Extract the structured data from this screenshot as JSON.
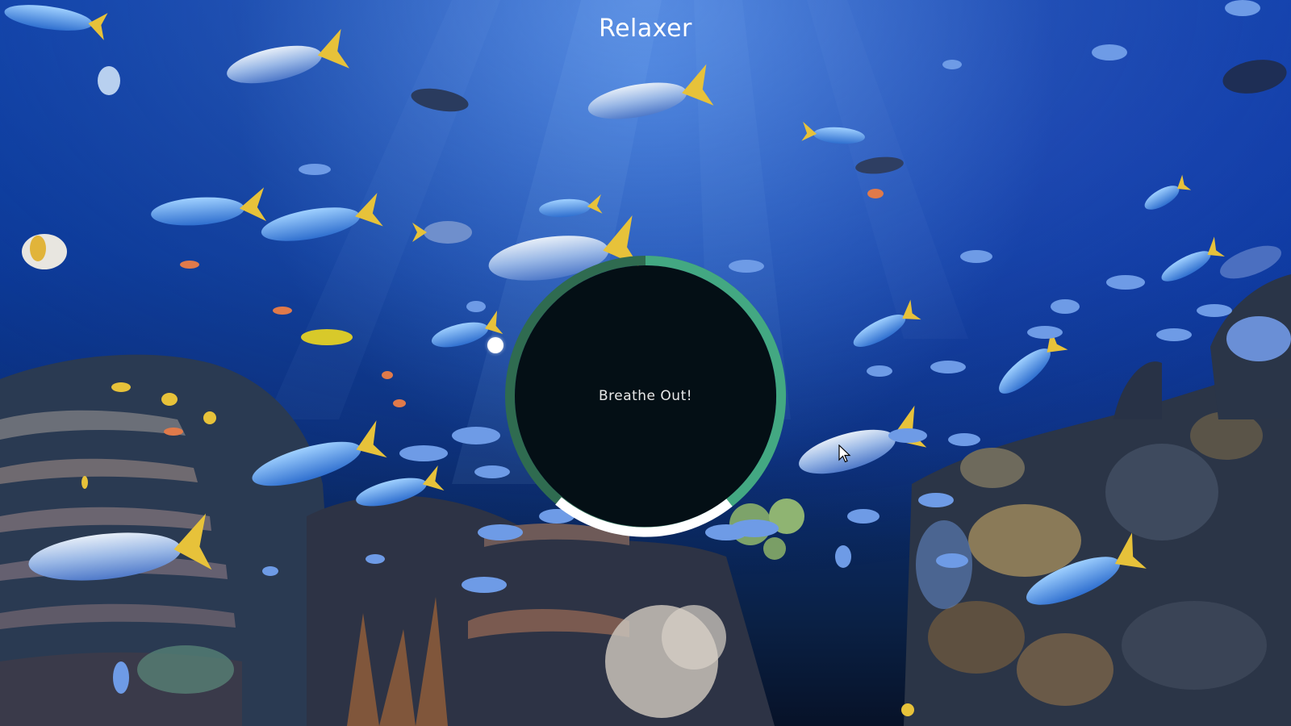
{
  "app": {
    "title": "Relaxer"
  },
  "breathing": {
    "instruction": "Breathe Out!",
    "ring_colors": {
      "inhale": "#43a882",
      "inhale_dark": "#2f6b50",
      "exhale": "#ffffff",
      "center": "#040f15"
    },
    "pointer_color": "#ffffff"
  },
  "background": {
    "description_icon": "underwater-reef-scene",
    "colors": {
      "deep": "#0a3898",
      "shallow": "#5aa0ff",
      "reef": "#3a4a58"
    }
  }
}
